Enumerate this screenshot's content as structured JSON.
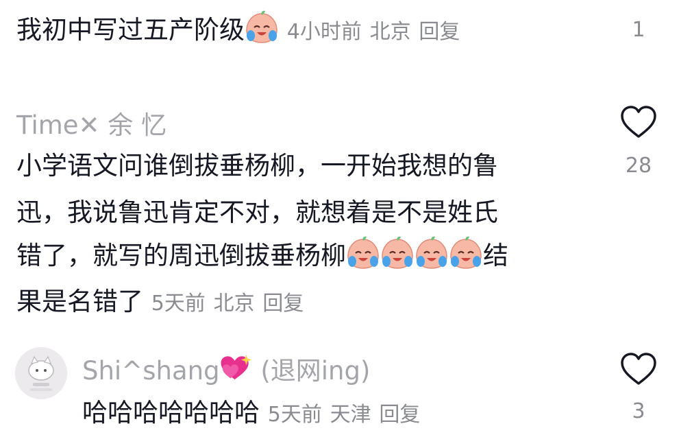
{
  "comments": [
    {
      "text": "我初中写过五产阶级",
      "emojis": [
        "crying-peach-emoji"
      ],
      "time": "4小时前",
      "location": "北京",
      "reply_label": "回复",
      "like_count": "1"
    },
    {
      "username": "Time✕ 余  忆",
      "lines": [
        "小学语文问谁倒拔垂杨柳，一开始我想的鲁",
        "迅，我说鲁迅肯定不对，就想着是不是姓氏",
        "错了，就写的周迅倒拔垂杨柳",
        "结",
        "果是名错了"
      ],
      "emojis": [
        "crying-peach-emoji",
        "crying-peach-emoji",
        "crying-peach-emoji",
        "crying-peach-emoji"
      ],
      "time": "5天前",
      "location": "北京",
      "reply_label": "回复",
      "like_count": "28",
      "like_icon": "heart-outline-icon"
    },
    {
      "username": "Shi^shang",
      "username_suffix": "(退网ing)",
      "username_emoji": "sparkling-hearts-emoji",
      "text": "哈哈哈哈哈哈哈",
      "time": "5天前",
      "location": "天津",
      "reply_label": "回复",
      "like_count": "3",
      "like_icon": "heart-outline-icon"
    }
  ],
  "colors": {
    "text": "#161823",
    "meta": "#8a8b91",
    "username": "#a4a5aa",
    "heart_stroke": "#161823",
    "emoji_face": "#f7b9a6",
    "emoji_tear": "#4aa3e8",
    "emoji_leaf": "#6cc27a",
    "sparkle_heart": "#e8318f"
  }
}
